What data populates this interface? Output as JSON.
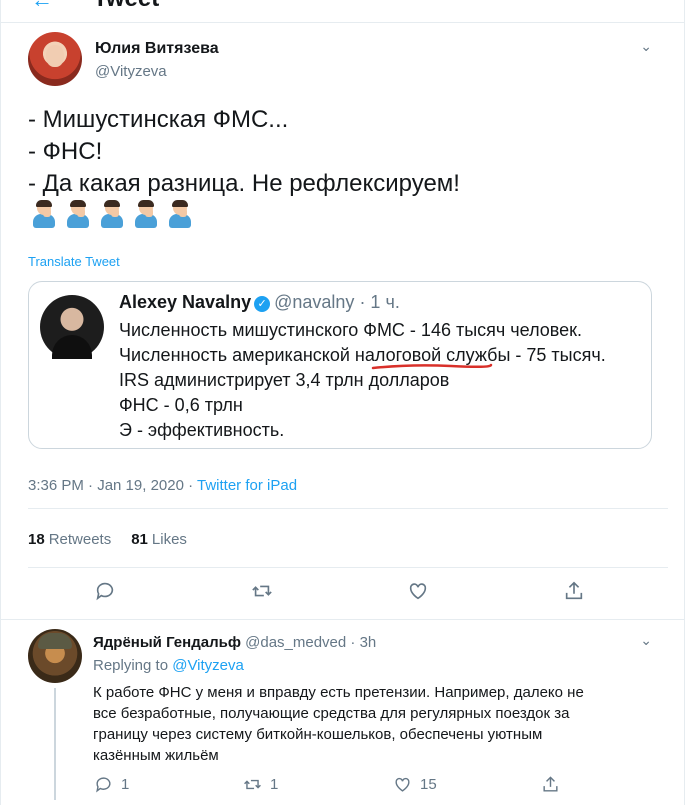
{
  "header": {
    "title": "Tweet",
    "back_icon": "back-arrow-icon"
  },
  "main_tweet": {
    "author_name": "Юлия Витязева",
    "author_handle": "@Vityzeva",
    "lines": [
      "- Мишустинская ФМС...",
      "- ФНС!",
      "- Да какая разница. Не рефлексируем!"
    ],
    "emoji_name": "facepalm-emoji",
    "emoji_count": 5,
    "translate_label": "Translate Tweet",
    "timestamp": "3:36 PM · Jan 19, 2020 · ",
    "source": "Twitter for iPad",
    "retweets_count": "18",
    "retweets_label": "Retweets",
    "likes_count": "81",
    "likes_label": "Likes"
  },
  "quoted_tweet": {
    "author_name": "Alexey Navalny",
    "author_handle": "@navalny",
    "time_ago": "· 1 ч.",
    "lines": [
      "Численность мишустинского ФМС - 146 тысяч человек.",
      "Численность американской налоговой службы - 75 тысяч.",
      "IRS администрирует 3,4 трлн долларов",
      "ФНС - 0,6 трлн",
      "Э - эффективность."
    ]
  },
  "reply_tweet": {
    "author_name": "Ядрёный Гендальф",
    "author_handle": "@das_medved",
    "time_ago": "· 3h",
    "replying_prefix": "Replying to ",
    "replying_to": "@Vityzeva",
    "lines": [
      "К работе ФНС у меня и вправду есть претензии. Например, далеко не",
      "все безработные, получающие средства для регулярных поездок за",
      "границу через систему биткойн-кошельков, обеспечены уютным",
      "казённым жильём"
    ],
    "reply_count": "1",
    "retweet_count": "1",
    "like_count": "15"
  },
  "colors": {
    "accent": "#1da1f2",
    "muted": "#657786",
    "text": "#14171a",
    "border": "#e6ecf0"
  }
}
